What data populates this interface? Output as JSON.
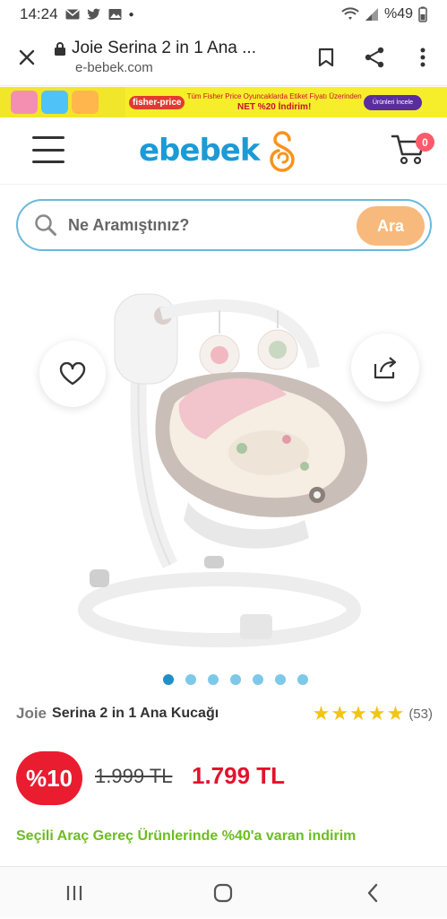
{
  "status_bar": {
    "time": "14:24",
    "battery": "%49",
    "left_icons": [
      "mail-icon",
      "twitter-icon",
      "image-icon",
      "dot-icon"
    ],
    "right_icons": [
      "wifi-icon",
      "signal-icon",
      "battery-icon"
    ]
  },
  "browser": {
    "title": "Joie Serina 2 in 1 Ana ...",
    "url": "e-bebek.com",
    "actions": [
      "bookmark-icon",
      "share-icon",
      "more-icon"
    ]
  },
  "banner": {
    "brand": "fisher-price",
    "line1": "Tüm Fisher Price Oyuncaklarda Etiket Fiyatı Üzerinden",
    "line2": "NET %20 İndirim!",
    "button": "Ürünleri İncele"
  },
  "header": {
    "logo": "ebebek",
    "cart_count": "0"
  },
  "search": {
    "placeholder": "Ne Aramıştınız?",
    "button": "Ara"
  },
  "carousel": {
    "total": 7,
    "active_index": 0
  },
  "product": {
    "brand": "Joie",
    "name": "Serina 2 in 1 Ana Kucağı",
    "rating": 5,
    "reviews": "(53)",
    "discount": "%10",
    "old_price": "1.999 TL",
    "new_price": "1.799 TL",
    "promo": "Seçili Araç Gereç Ürünlerinde %40'a varan indirim"
  },
  "colors": {
    "brand_blue": "#1c9ad6",
    "accent_orange": "#f8b97c",
    "discount_red": "#ea1c2f",
    "promo_green": "#6bbe1f",
    "star_yellow": "#f3c414"
  }
}
